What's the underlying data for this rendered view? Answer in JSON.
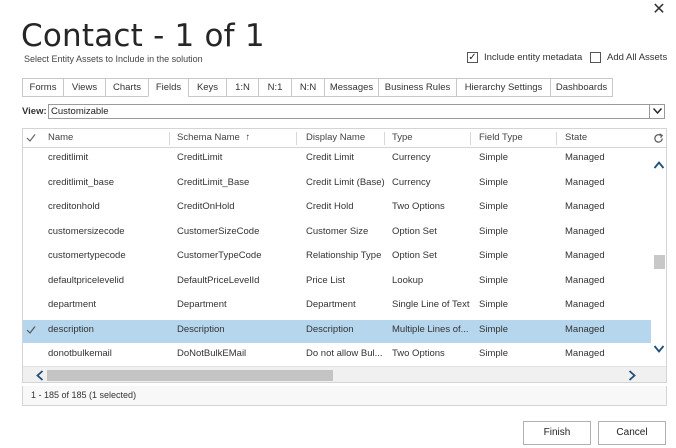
{
  "dialog": {
    "close_glyph": "✕",
    "title": "Contact - 1 of 1",
    "subtitle": "Select Entity Assets to Include in the solution",
    "include_metadata": {
      "label": "Include entity metadata",
      "checked": true
    },
    "add_all_assets": {
      "label": "Add All Assets",
      "checked": false
    }
  },
  "tabs": [
    {
      "label": "Forms",
      "active": false
    },
    {
      "label": "Views",
      "active": false
    },
    {
      "label": "Charts",
      "active": false
    },
    {
      "label": "Fields",
      "active": true
    },
    {
      "label": "Keys",
      "active": false
    },
    {
      "label": "1:N",
      "active": false
    },
    {
      "label": "N:1",
      "active": false
    },
    {
      "label": "N:N",
      "active": false
    },
    {
      "label": "Messages",
      "active": false
    },
    {
      "label": "Business Rules",
      "active": false
    },
    {
      "label": "Hierarchy Settings",
      "active": false
    },
    {
      "label": "Dashboards",
      "active": false
    }
  ],
  "view": {
    "label": "View:",
    "selected": "Customizable"
  },
  "grid": {
    "columns": [
      "Name",
      "Schema Name",
      "Display Name",
      "Type",
      "Field Type",
      "State"
    ],
    "sort_indicator": "↑",
    "rows": [
      {
        "name": "creditlimit",
        "schema": "CreditLimit",
        "display": "Credit Limit",
        "type": "Currency",
        "field_type": "Simple",
        "state": "Managed",
        "selected": false
      },
      {
        "name": "creditlimit_base",
        "schema": "CreditLimit_Base",
        "display": "Credit Limit (Base)",
        "type": "Currency",
        "field_type": "Simple",
        "state": "Managed",
        "selected": false
      },
      {
        "name": "creditonhold",
        "schema": "CreditOnHold",
        "display": "Credit Hold",
        "type": "Two Options",
        "field_type": "Simple",
        "state": "Managed",
        "selected": false
      },
      {
        "name": "customersizecode",
        "schema": "CustomerSizeCode",
        "display": "Customer Size",
        "type": "Option Set",
        "field_type": "Simple",
        "state": "Managed",
        "selected": false
      },
      {
        "name": "customertypecode",
        "schema": "CustomerTypeCode",
        "display": "Relationship Type",
        "type": "Option Set",
        "field_type": "Simple",
        "state": "Managed",
        "selected": false
      },
      {
        "name": "defaultpricelevelid",
        "schema": "DefaultPriceLevelId",
        "display": "Price List",
        "type": "Lookup",
        "field_type": "Simple",
        "state": "Managed",
        "selected": false
      },
      {
        "name": "department",
        "schema": "Department",
        "display": "Department",
        "type": "Single Line of Text",
        "field_type": "Simple",
        "state": "Managed",
        "selected": false
      },
      {
        "name": "description",
        "schema": "Description",
        "display": "Description",
        "type": "Multiple Lines of...",
        "field_type": "Simple",
        "state": "Managed",
        "selected": true
      },
      {
        "name": "donotbulkemail",
        "schema": "DoNotBulkEMail",
        "display": "Do not allow Bul...",
        "type": "Two Options",
        "field_type": "Simple",
        "state": "Managed",
        "selected": false
      }
    ],
    "status": "1 - 185 of 185 (1 selected)"
  },
  "buttons": {
    "finish": "Finish",
    "cancel": "Cancel"
  },
  "colors": {
    "selected_row": "#b6d6ee",
    "border": "#d4d4d4",
    "scroll_thumb": "#c4c4c4"
  }
}
